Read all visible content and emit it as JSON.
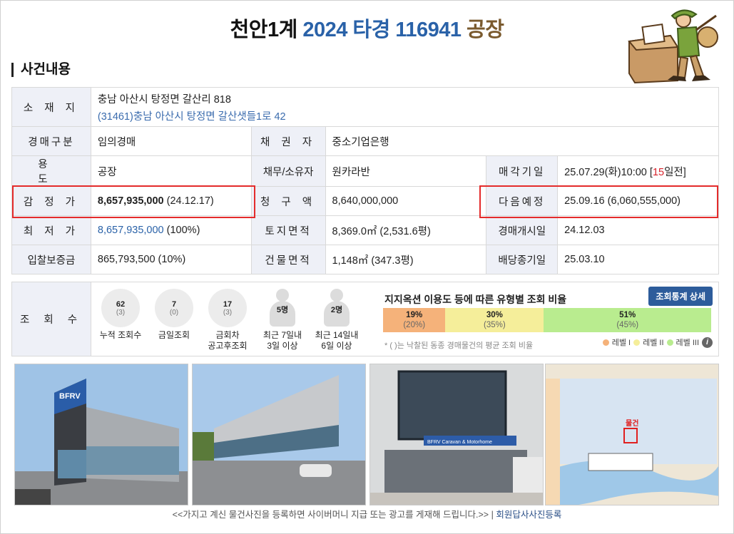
{
  "header": {
    "court": "천안1계",
    "case_no": "2024 타경 116941",
    "category": "공장"
  },
  "section_title": "사건내용",
  "info": {
    "location_label": "소 재 지",
    "address": "충남 아산시 탕정면 갈산리 818",
    "road_address": "(31461)충남 아산시  탕정면 갈산샛들1로  42",
    "auction_type_label": "경매구분",
    "auction_type": "임의경매",
    "creditor_label": "채 권 자",
    "creditor": "중소기업은행",
    "use_label": "용 도",
    "use": "공장",
    "debtor_label": "채무/소유자",
    "debtor": "원카라반",
    "sale_date_label": "매각기일",
    "sale_date": "25.07.29(화)10:00 [",
    "sale_days": "15",
    "sale_days_suffix": "일전]",
    "appraisal_label": "감 정 가",
    "appraisal": "8,657,935,000",
    "appraisal_date": " (24.12.17)",
    "claim_label": "청 구 액",
    "claim": "8,640,000,000",
    "next_label": "다음예정",
    "next_value": "25.09.16 (6,060,555,000)",
    "min_price_label": "최 저 가",
    "min_price": "8,657,935,000",
    "min_price_pct": " (100%)",
    "land_label": "토지면적",
    "land_area": "8,369.0㎡ (2,531.6평)",
    "start_label": "경매개시일",
    "start_date": "24.12.03",
    "deposit_label": "입찰보증금",
    "deposit": "865,793,500 (10%)",
    "building_label": "건물면적",
    "building_area": "1,148㎡ (347.3평)",
    "dividend_label": "배당종기일",
    "dividend_date": "25.03.10"
  },
  "views": {
    "label": "조 회 수",
    "stats": [
      {
        "n": "62",
        "p": "(3)",
        "label": "누적 조회수"
      },
      {
        "n": "7",
        "p": "(0)",
        "label": "금일조회"
      },
      {
        "n": "17",
        "p": "(3)",
        "label": "금회차\n공고후조회"
      },
      {
        "n": "5명",
        "label": "최근 7일내\n3일 이상"
      },
      {
        "n": "2명",
        "label": "최근 14일내\n6일 이상"
      }
    ],
    "ratio_title": "지지옥션 이용도 등에 따른 유형별 조회 비율",
    "ratio_button": "조회통계 상세",
    "segments": [
      {
        "pct": "19%",
        "sub": "(20%)",
        "value": 0.19,
        "color": "#f5b27a"
      },
      {
        "pct": "30%",
        "sub": "(35%)",
        "value": 0.3,
        "color": "#f5ee9a"
      },
      {
        "pct": "51%",
        "sub": "(45%)",
        "value": 0.51,
        "color": "#b9ec8f"
      }
    ],
    "note": "* ( )는 낙찰된 동종 경매물건의 평균 조회 비율",
    "legend": [
      "레벨 I",
      "레벨 II",
      "레벨 III"
    ],
    "legend_colors": [
      "#f5b27a",
      "#f5ee9a",
      "#b9ec8f"
    ]
  },
  "photo_texts": {
    "sign1": "BFRV",
    "sign2": "BFRV Caravan & Motorhome",
    "map_label": "물건"
  },
  "footer": {
    "notice": "<<가지고 계신 물건사진을 등록하면 사이버머니 지급 또는 광고를 게재해 드립니다.>>",
    "separator": "|",
    "register": "회원답사사진등록"
  }
}
